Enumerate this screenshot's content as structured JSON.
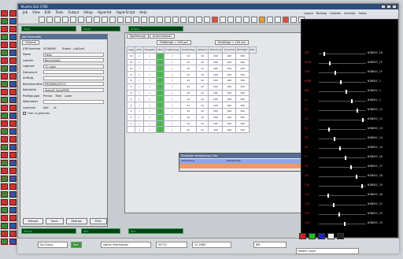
{
  "window": {
    "title": "Illustra SLS 3700",
    "brand": "Illustra"
  },
  "menu": [
    "Job",
    "View",
    "Edit",
    "Tools",
    "Output",
    "Setup",
    "Hyperlist",
    "HyperScript",
    "Help"
  ],
  "right_menu": [
    "Layout",
    "Buildup",
    "Outputs",
    "Activate",
    "Setup"
  ],
  "leds": {
    "top1": "Total",
    "top2": "Zone",
    "top3": "Status",
    "bot1": "Ready",
    "bot2": "Idle",
    "bot3": "Run"
  },
  "form": {
    "title": "Job Parameter",
    "tab": "General",
    "header_fields": {
      "job": "JOB Nummer",
      "job_val": "S236006",
      "status": "Status",
      "status_val": "Lst/Ausf"
    },
    "fields": [
      {
        "label": "Name",
        "value": "Fields"
      },
      {
        "label": "Laeufer",
        "value": "Benchmarks"
      },
      {
        "label": "Lagerort",
        "value": "TC Lager"
      },
      {
        "label": "Dokument",
        "value": ""
      },
      {
        "label": "Auftrag",
        "value": ""
      },
      {
        "label": "Betriebsmittel",
        "value": "PROD/RA/ST/FCS"
      },
      {
        "label": "Kaltstarte",
        "value": "Statistik ValuePERS"
      }
    ],
    "radio_label": "Profilgruppe",
    "radio_opts": [
      "Primar",
      "Rest",
      "Laser"
    ],
    "material_label": "Materialart",
    "laser_label": "Laserzeit",
    "laser_opts": [
      "Kalt",
      "x1"
    ],
    "check_label": "Fuer zu plannen",
    "buttons": [
      "Reload",
      "Save",
      "Redraw",
      "Print"
    ]
  },
  "table": {
    "tabs": [
      "Kopfmenge",
      "Aufschluessel"
    ],
    "sub": [
      "Feldfenge = 100 µm",
      "Fieldlinge = 100 µm"
    ],
    "headers": [
      "Lage",
      "Aktiv",
      "Freigabe",
      "Aktiv",
      "Fuellmenge",
      "Fuellanlage",
      "Abstand",
      "Stromlinie",
      "Vorschub",
      "EST-Wert",
      "Zeit"
    ],
    "rows": [
      [
        "12",
        "√",
        "√",
        "√",
        "√",
        "12",
        "12",
        "100",
        "100",
        "150"
      ],
      [
        "11",
        "√",
        "√",
        "√",
        "√",
        "12",
        "12",
        "100",
        "100",
        "100"
      ],
      [
        "10",
        "√",
        "√",
        "√",
        "√",
        "12",
        "12",
        "100",
        "100",
        "100"
      ],
      [
        "9",
        "√",
        "√",
        "√",
        "√",
        "12",
        "12",
        "100",
        "100",
        "120"
      ],
      [
        "8",
        "√",
        "√",
        "√",
        "√",
        "12",
        "12",
        "100",
        "100",
        "150"
      ],
      [
        "7",
        "√",
        "√",
        "√",
        "√",
        "12",
        "12",
        "100",
        "100",
        "120"
      ],
      [
        "6",
        "√",
        "√",
        "√",
        "√",
        "12",
        "12",
        "100",
        "120",
        "150"
      ],
      [
        "5",
        "√",
        "√",
        "√",
        "√",
        "12",
        "12",
        "100",
        "100",
        "100"
      ],
      [
        "4",
        "√",
        "√",
        "√",
        "√",
        "12",
        "12",
        "100",
        "100",
        "100"
      ],
      [
        "3",
        "√",
        "√",
        "√",
        "√",
        "12",
        "12",
        "100",
        "100",
        "150"
      ],
      [
        "2",
        "√",
        "√",
        "√",
        "√",
        "12",
        "12",
        "100",
        "100",
        "150"
      ],
      [
        "1",
        "√",
        "√",
        "√",
        "√",
        "12",
        "12",
        "100",
        "100",
        "150"
      ],
      [
        "",
        "√",
        "√",
        "√",
        "√",
        "12",
        "12",
        "100",
        "100",
        "150"
      ]
    ]
  },
  "dialog": {
    "title": "Strategie Verbindung Liste",
    "c1": "Verbindung",
    "c2": "Reihenfolge"
  },
  "dark_panel": {
    "labels": [
      "CHT",
      "PLAS",
      "ICR",
      "HTAB",
      "OUT",
      "C1",
      "C2",
      "C3",
      "C4",
      "C5",
      "C6",
      "C7",
      "C8",
      "C9",
      "C10",
      "C11",
      "C12",
      "C13",
      "C14"
    ],
    "values": [
      "WINDSS_LB",
      "WINDSS_LF",
      "WINDSS_1F",
      "WINDSS_1",
      "WINDSS_1",
      "WINDSS_1",
      "WINDSS_11",
      "WINDSS_12",
      "WINDSS_13",
      "WINDSS_14",
      "WINDSS_15",
      "WINDSS_16",
      "WINDSS_17",
      "WINDSS_18",
      "WINDSS_19",
      "WINDSS_20",
      "WINDSS_21",
      "WINDSS_22",
      "WINDSS_23"
    ]
  },
  "status": {
    "gruppe": "No Group",
    "val1": "Std",
    "info": "status information",
    "num": "05712",
    "coord": "12.2080",
    "zoom": "6M",
    "footer": "Modify Laser"
  },
  "colors": {
    "accent": "#2c4c7a",
    "green": "#4dbb55",
    "red": "#e33",
    "dark": "#000"
  }
}
